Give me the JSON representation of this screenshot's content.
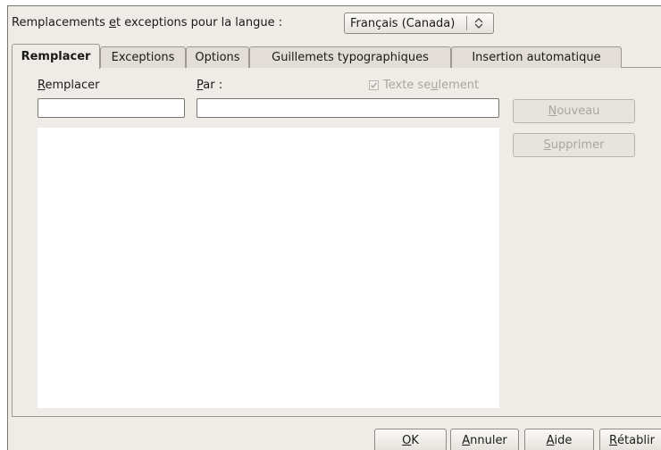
{
  "language_row": {
    "label_pre": "Remplacements ",
    "label_key": "e",
    "label_post": "t exceptions pour la langue :",
    "selected_language": "Français (Canada)"
  },
  "tabs": [
    {
      "label": "Remplacer",
      "active": true
    },
    {
      "label": "Exceptions",
      "active": false
    },
    {
      "label": "Options",
      "active": false
    },
    {
      "label": "Guillemets typographiques",
      "active": false
    },
    {
      "label": "Insertion automatique",
      "active": false
    }
  ],
  "replace_tab": {
    "replace_label_key": "R",
    "replace_label_rest": "emplacer",
    "replace_value": "",
    "with_label_key": "P",
    "with_label_rest": "ar :",
    "with_value": "",
    "text_only_pre": "Texte se",
    "text_only_key": "u",
    "text_only_post": "lement",
    "text_only_checked": true,
    "new_button_key": "N",
    "new_button_rest": "ouveau",
    "delete_button_key": "S",
    "delete_button_rest": "upprimer"
  },
  "footer": {
    "ok_key": "O",
    "ok_rest": "K",
    "cancel_key": "A",
    "cancel_rest": "nnuler",
    "help_key": "A",
    "help_rest": "ide",
    "reset_key": "R",
    "reset_rest": "établir"
  }
}
